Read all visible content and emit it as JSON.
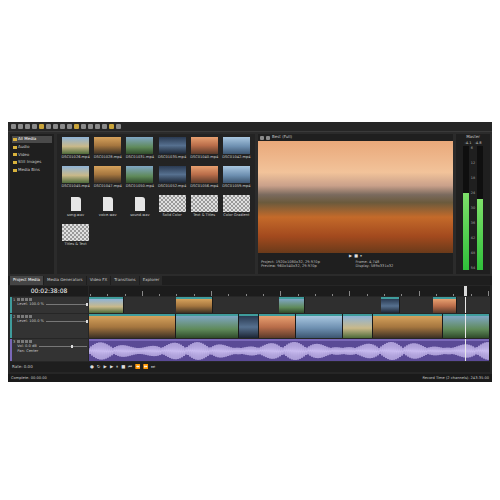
{
  "explorer": {
    "items": [
      {
        "label": "All Media",
        "selected": true
      },
      {
        "label": "Audio",
        "selected": false
      },
      {
        "label": "Video",
        "selected": false
      },
      {
        "label": "Still Images",
        "selected": false
      },
      {
        "label": "Media Bins",
        "selected": false
      }
    ]
  },
  "media": [
    {
      "name": "DSC01026.mp4",
      "kind": "video"
    },
    {
      "name": "DSC01028.mp4",
      "kind": "video"
    },
    {
      "name": "DSC01031.mp4",
      "kind": "video"
    },
    {
      "name": "DSC01035.mp4",
      "kind": "video"
    },
    {
      "name": "DSC01040.mp4",
      "kind": "video"
    },
    {
      "name": "DSC01042.mp4",
      "kind": "video"
    },
    {
      "name": "DSC01045.mp4",
      "kind": "video"
    },
    {
      "name": "DSC01047.mp4",
      "kind": "video"
    },
    {
      "name": "DSC01050.mp4",
      "kind": "video"
    },
    {
      "name": "DSC01052.mp4",
      "kind": "video"
    },
    {
      "name": "DSC01056.mp4",
      "kind": "video"
    },
    {
      "name": "DSC01059.mp4",
      "kind": "video"
    },
    {
      "name": "song.wav",
      "kind": "audio"
    },
    {
      "name": "voice.wav",
      "kind": "audio"
    },
    {
      "name": "sound.wav",
      "kind": "audio"
    },
    {
      "name": "Solid Color",
      "kind": "generated"
    },
    {
      "name": "Text & Titles",
      "kind": "generated"
    },
    {
      "name": "Color Gradient",
      "kind": "generated"
    },
    {
      "name": "Titles & Text",
      "kind": "generated"
    }
  ],
  "preview": {
    "title": "Best (Full)",
    "controls": [
      "▶",
      "■",
      "⏸"
    ],
    "info": [
      "Project: 1920x1080x32, 29.970p",
      "Frame: 4,748",
      "Preview: 960x540x32, 29.970p",
      "Display: 589x331x32"
    ]
  },
  "meter": {
    "title": "Master",
    "channels": [
      {
        "level": 0.62
      },
      {
        "level": 0.57
      }
    ],
    "scale": [
      "6",
      "12",
      "18",
      "24",
      "30",
      "36",
      "42",
      "48",
      "54"
    ],
    "readings": [
      "-4.1",
      "-4.8"
    ]
  },
  "tabs": [
    {
      "label": "Project Media",
      "selected": true
    },
    {
      "label": "Media Generators",
      "selected": false
    },
    {
      "label": "Video FX",
      "selected": false
    },
    {
      "label": "Transitions",
      "selected": false
    },
    {
      "label": "Explorer",
      "selected": false
    }
  ],
  "timeline": {
    "timecode": "00:02:38:08",
    "duration": 240,
    "cursor": 225,
    "tracks": [
      {
        "kind": "video",
        "number": "1",
        "label": "Level: 100.0 %",
        "level": 1.0,
        "color": "#3f9c9c",
        "clips": [
          {
            "start": 0,
            "length": 21
          },
          {
            "start": 52,
            "length": 22
          },
          {
            "start": 114,
            "length": 15
          },
          {
            "start": 175,
            "length": 11
          },
          {
            "start": 206,
            "length": 14
          }
        ]
      },
      {
        "kind": "video",
        "number": "2",
        "label": "Level: 100.0 %",
        "level": 1.0,
        "color": "#3f9c9c",
        "clips": [
          {
            "start": 0,
            "length": 52
          },
          {
            "start": 52,
            "length": 38
          },
          {
            "start": 90,
            "length": 12
          },
          {
            "start": 102,
            "length": 22
          },
          {
            "start": 124,
            "length": 28
          },
          {
            "start": 152,
            "length": 18
          },
          {
            "start": 170,
            "length": 42
          },
          {
            "start": 212,
            "length": 28
          }
        ]
      },
      {
        "kind": "audio",
        "number": "3",
        "label": "Vol: 0.0 dB",
        "sublabel": "Pan: Center",
        "level": 0.7,
        "color": "#7a68b8",
        "clips": [
          {
            "start": 0,
            "length": 240
          }
        ]
      }
    ]
  },
  "transport": {
    "buttons": [
      "●",
      "↻",
      "▶",
      "▶",
      "⏸",
      "■",
      "⏮",
      "⏪",
      "⏩",
      "⏭"
    ],
    "rate": "Rate: 0.00"
  },
  "status_bar": {
    "left": "Complete: 00:00:00",
    "right": "Record Time (2 channels): 243:35:00"
  }
}
